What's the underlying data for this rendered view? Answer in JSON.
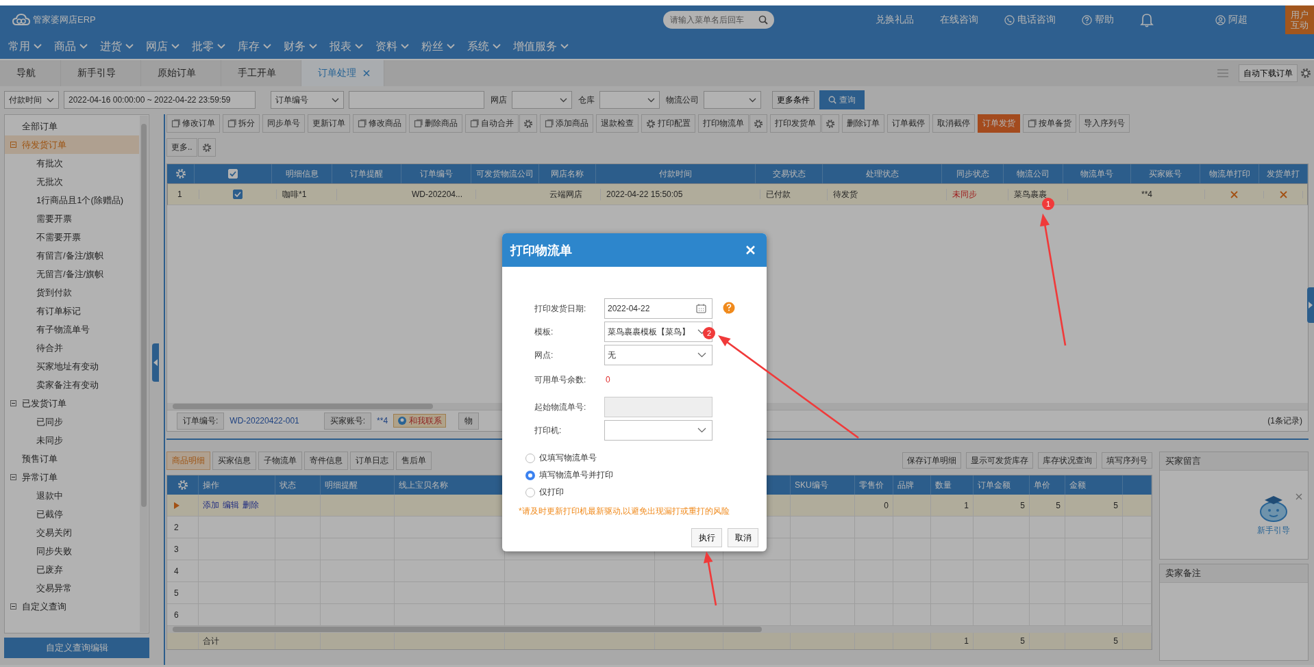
{
  "header": {
    "logo": "管家婆网店ERP",
    "search": {
      "placeholder": "请输入菜单名后回车"
    },
    "links": [
      {
        "label": "兑换礼品",
        "kind": "text"
      },
      {
        "label": "在线咨询",
        "kind": "text"
      },
      {
        "label": "电话咨询",
        "kind": "phone"
      },
      {
        "label": "帮助",
        "kind": "help"
      }
    ],
    "user": "阿超",
    "interact": "用户互动"
  },
  "menu": [
    "常用",
    "商品",
    "进货",
    "网店",
    "批零",
    "库存",
    "财务",
    "报表",
    "资料",
    "粉丝",
    "系统",
    "增值服务"
  ],
  "tabs": [
    {
      "label": "导航",
      "selected": false,
      "closable": false
    },
    {
      "label": "新手引导",
      "selected": false,
      "closable": false
    },
    {
      "label": "原始订单",
      "selected": false,
      "closable": false
    },
    {
      "label": "手工开单",
      "selected": false,
      "closable": false
    },
    {
      "label": "订单处理",
      "selected": true,
      "closable": true
    }
  ],
  "auto_download": "自动下载订单",
  "filters": {
    "time_type": "付款时间",
    "date_range": "2022-04-16 00:00:00 ~ 2022-04-22 23:59:59",
    "field_type": "订单编号",
    "shop_label": "网店",
    "warehouse_label": "仓库",
    "logistics_label": "物流公司",
    "more": "更多条件",
    "query": "查询"
  },
  "sidebar": {
    "tree": [
      {
        "label": "全部订单",
        "selected": false
      },
      {
        "label": "待发货订单",
        "selected": true,
        "expanded": true,
        "children": [
          {
            "label": "有批次",
            "selected": false
          },
          {
            "label": "无批次",
            "selected": false
          },
          {
            "label": "1行商品且1个(除赠品)",
            "selected": false
          },
          {
            "label": "需要开票",
            "selected": false
          },
          {
            "label": "不需要开票",
            "selected": false
          },
          {
            "label": "有留言/备注/旗帜",
            "selected": false
          },
          {
            "label": "无留言/备注/旗帜",
            "selected": false
          },
          {
            "label": "货到付款",
            "selected": false
          },
          {
            "label": "有订单标记",
            "selected": false
          },
          {
            "label": "有子物流单号",
            "selected": false
          },
          {
            "label": "待合并",
            "selected": false
          },
          {
            "label": "买家地址有变动",
            "selected": false
          },
          {
            "label": "卖家备注有变动",
            "selected": false
          }
        ]
      },
      {
        "label": "已发货订单",
        "selected": false,
        "expanded": true,
        "children": [
          {
            "label": "已同步",
            "selected": false
          },
          {
            "label": "未同步",
            "selected": false
          }
        ]
      },
      {
        "label": "预售订单",
        "selected": false
      },
      {
        "label": "异常订单",
        "selected": false,
        "expanded": true,
        "children": [
          {
            "label": "退款中",
            "selected": false
          },
          {
            "label": "已截停",
            "selected": false
          },
          {
            "label": "交易关闭",
            "selected": false
          },
          {
            "label": "同步失败",
            "selected": false
          },
          {
            "label": "已废弃",
            "selected": false
          },
          {
            "label": "交易异常",
            "selected": false
          }
        ]
      },
      {
        "label": "自定义查询",
        "selected": false,
        "expanded": true
      }
    ],
    "edit_button": "自定义查询编辑"
  },
  "toolbar_rows": [
    [
      {
        "label": "修改订单",
        "kind": "icon",
        "settings": false
      },
      {
        "label": "拆分",
        "kind": "icon",
        "settings": false
      },
      {
        "label": "同步单号",
        "kind": "plain",
        "settings": false
      },
      {
        "label": "更新订单",
        "kind": "plain",
        "settings": false
      },
      {
        "label": "修改商品",
        "kind": "icon",
        "settings": false
      },
      {
        "label": "删除商品",
        "kind": "icon",
        "settings": false
      },
      {
        "label": "自动合并",
        "kind": "icon",
        "settings": true
      },
      {
        "label": "添加商品",
        "kind": "icon",
        "settings": false
      },
      {
        "label": "退款检查",
        "kind": "plain",
        "settings": false
      },
      {
        "label": "打印配置",
        "kind": "gear",
        "settings": false
      },
      {
        "label": "打印物流单",
        "kind": "plain",
        "settings": true
      },
      {
        "label": "打印发货单",
        "kind": "plain",
        "settings": true
      },
      {
        "label": "删除订单",
        "kind": "plain",
        "settings": false
      },
      {
        "label": "订单截停",
        "kind": "plain",
        "settings": false
      },
      {
        "label": "取消截停",
        "kind": "plain",
        "settings": false
      },
      {
        "label": "订单发货",
        "kind": "primary",
        "settings": false
      },
      {
        "label": "按单备货",
        "kind": "icon",
        "settings": false
      },
      {
        "label": "导入序列号",
        "kind": "plain",
        "settings": false
      }
    ],
    [
      {
        "label": "更多..",
        "kind": "plain",
        "settings": true
      }
    ]
  ],
  "grid": {
    "columns": [
      {
        "kind": "settings"
      },
      {
        "kind": "checkbox",
        "checked": true
      },
      {
        "kind": "text",
        "label": "明细信息"
      },
      {
        "kind": "text",
        "label": "订单提醒"
      },
      {
        "kind": "text",
        "label": "订单编号"
      },
      {
        "kind": "text",
        "label": "可发货物流公司"
      },
      {
        "kind": "text",
        "label": "网店名称"
      },
      {
        "kind": "text",
        "label": "付款时间"
      },
      {
        "kind": "text",
        "label": "交易状态"
      },
      {
        "kind": "text",
        "label": "处理状态"
      },
      {
        "kind": "text",
        "label": "同步状态"
      },
      {
        "kind": "text",
        "label": "物流公司"
      },
      {
        "kind": "text",
        "label": "物流单号"
      },
      {
        "kind": "text",
        "label": "买家账号"
      },
      {
        "kind": "text",
        "label": "物流单打印"
      },
      {
        "kind": "text",
        "label": "发货单打"
      }
    ],
    "rows": [
      {
        "selected": true,
        "cells": [
          "1",
          {
            "checked": true
          },
          "咖啡*1",
          null,
          "WD-202204...",
          null,
          "云端网店",
          "2022-04-22 15:50:05",
          "已付款",
          "待发货",
          {
            "text": "未同步",
            "synced": false
          },
          "菜鸟裹裹",
          null,
          "**4",
          {
            "printed": false
          },
          {
            "printed": false
          }
        ]
      }
    ]
  },
  "info_bar": {
    "order_no_label": "订单编号:",
    "order_no": "WD-20220422-001",
    "buyer_label": "买家账号:",
    "buyer": "**4",
    "contact": "和我联系",
    "cut_label": "物",
    "count": "(1条记录)"
  },
  "detail": {
    "tabs": [
      {
        "label": "商品明细",
        "selected": true
      },
      {
        "label": "买家信息",
        "selected": false
      },
      {
        "label": "子物流单",
        "selected": false
      },
      {
        "label": "寄件信息",
        "selected": false
      },
      {
        "label": "订单日志",
        "selected": false
      },
      {
        "label": "售后单",
        "selected": false
      }
    ],
    "actions": [
      "保存订单明细",
      "显示可发货库存",
      "库存状况查询",
      "填写序列号"
    ],
    "columns": [
      {
        "kind": "settings"
      },
      {
        "label": "操作"
      },
      {
        "label": "状态"
      },
      {
        "label": "明细提醒"
      },
      {
        "label": "线上宝贝名称"
      },
      {},
      {},
      {},
      {
        "label": "SKU编号"
      },
      {
        "label": "零售价"
      },
      {
        "label": "品牌"
      },
      {
        "label": "数量"
      },
      {
        "label": "订单金额"
      },
      {
        "label": "单价"
      },
      {
        "label": "金额"
      },
      {}
    ],
    "rows": [
      {
        "current": true,
        "cells": [
          null,
          [
            "添加",
            "编辑",
            "删除"
          ],
          null,
          null,
          null,
          null,
          null,
          null,
          null,
          "0",
          null,
          "1",
          "5",
          "5",
          "5",
          null
        ]
      },
      {
        "current": false,
        "cells": [
          "2",
          null,
          null,
          null,
          null,
          null,
          null,
          null,
          null,
          null,
          null,
          null,
          null,
          null,
          null,
          null
        ]
      },
      {
        "current": false,
        "cells": [
          "3",
          null,
          null,
          null,
          null,
          null,
          null,
          null,
          null,
          null,
          null,
          null,
          null,
          null,
          null,
          null
        ]
      },
      {
        "current": false,
        "cells": [
          "4",
          null,
          null,
          null,
          null,
          null,
          null,
          null,
          null,
          null,
          null,
          null,
          null,
          null,
          null,
          null
        ]
      },
      {
        "current": false,
        "cells": [
          "5",
          null,
          null,
          null,
          null,
          null,
          null,
          null,
          null,
          null,
          null,
          null,
          null,
          null,
          null,
          null
        ]
      },
      {
        "current": false,
        "cells": [
          "6",
          null,
          null,
          null,
          null,
          null,
          null,
          null,
          null,
          null,
          null,
          null,
          null,
          null,
          null,
          null
        ]
      }
    ],
    "total": {
      "cells": [
        null,
        "合计",
        null,
        null,
        null,
        null,
        null,
        null,
        null,
        null,
        null,
        "1",
        "5",
        null,
        "5",
        null
      ]
    }
  },
  "notes": {
    "buyer_note": "买家留言",
    "guide": "新手引导",
    "seller_note": "卖家备注"
  },
  "dialog": {
    "title": "打印物流单",
    "fields": [
      {
        "label": "打印发货日期:",
        "kind": "date",
        "value": "2022-04-22",
        "help": true
      },
      {
        "label": "模板:",
        "kind": "select",
        "value": "菜鸟裹裹模板【菜鸟】"
      },
      {
        "label": "网点:",
        "kind": "select",
        "value": "无"
      },
      {
        "label": "可用单号余数:",
        "kind": "count",
        "value": "0"
      },
      {
        "label": "起始物流单号:",
        "kind": "disabled"
      },
      {
        "label": "打印机:",
        "kind": "select"
      }
    ],
    "options": [
      {
        "label": "仅填写物流单号",
        "selected": false
      },
      {
        "label": "填写物流单号并打印",
        "selected": true
      },
      {
        "label": "仅打印",
        "selected": false
      }
    ],
    "warning": "*请及时更新打印机最新驱动,以避免出现漏打或重打的风险",
    "buttons": [
      "执行",
      "取消"
    ]
  },
  "annotations": [
    {
      "label": "1"
    },
    {
      "label": "2"
    }
  ]
}
